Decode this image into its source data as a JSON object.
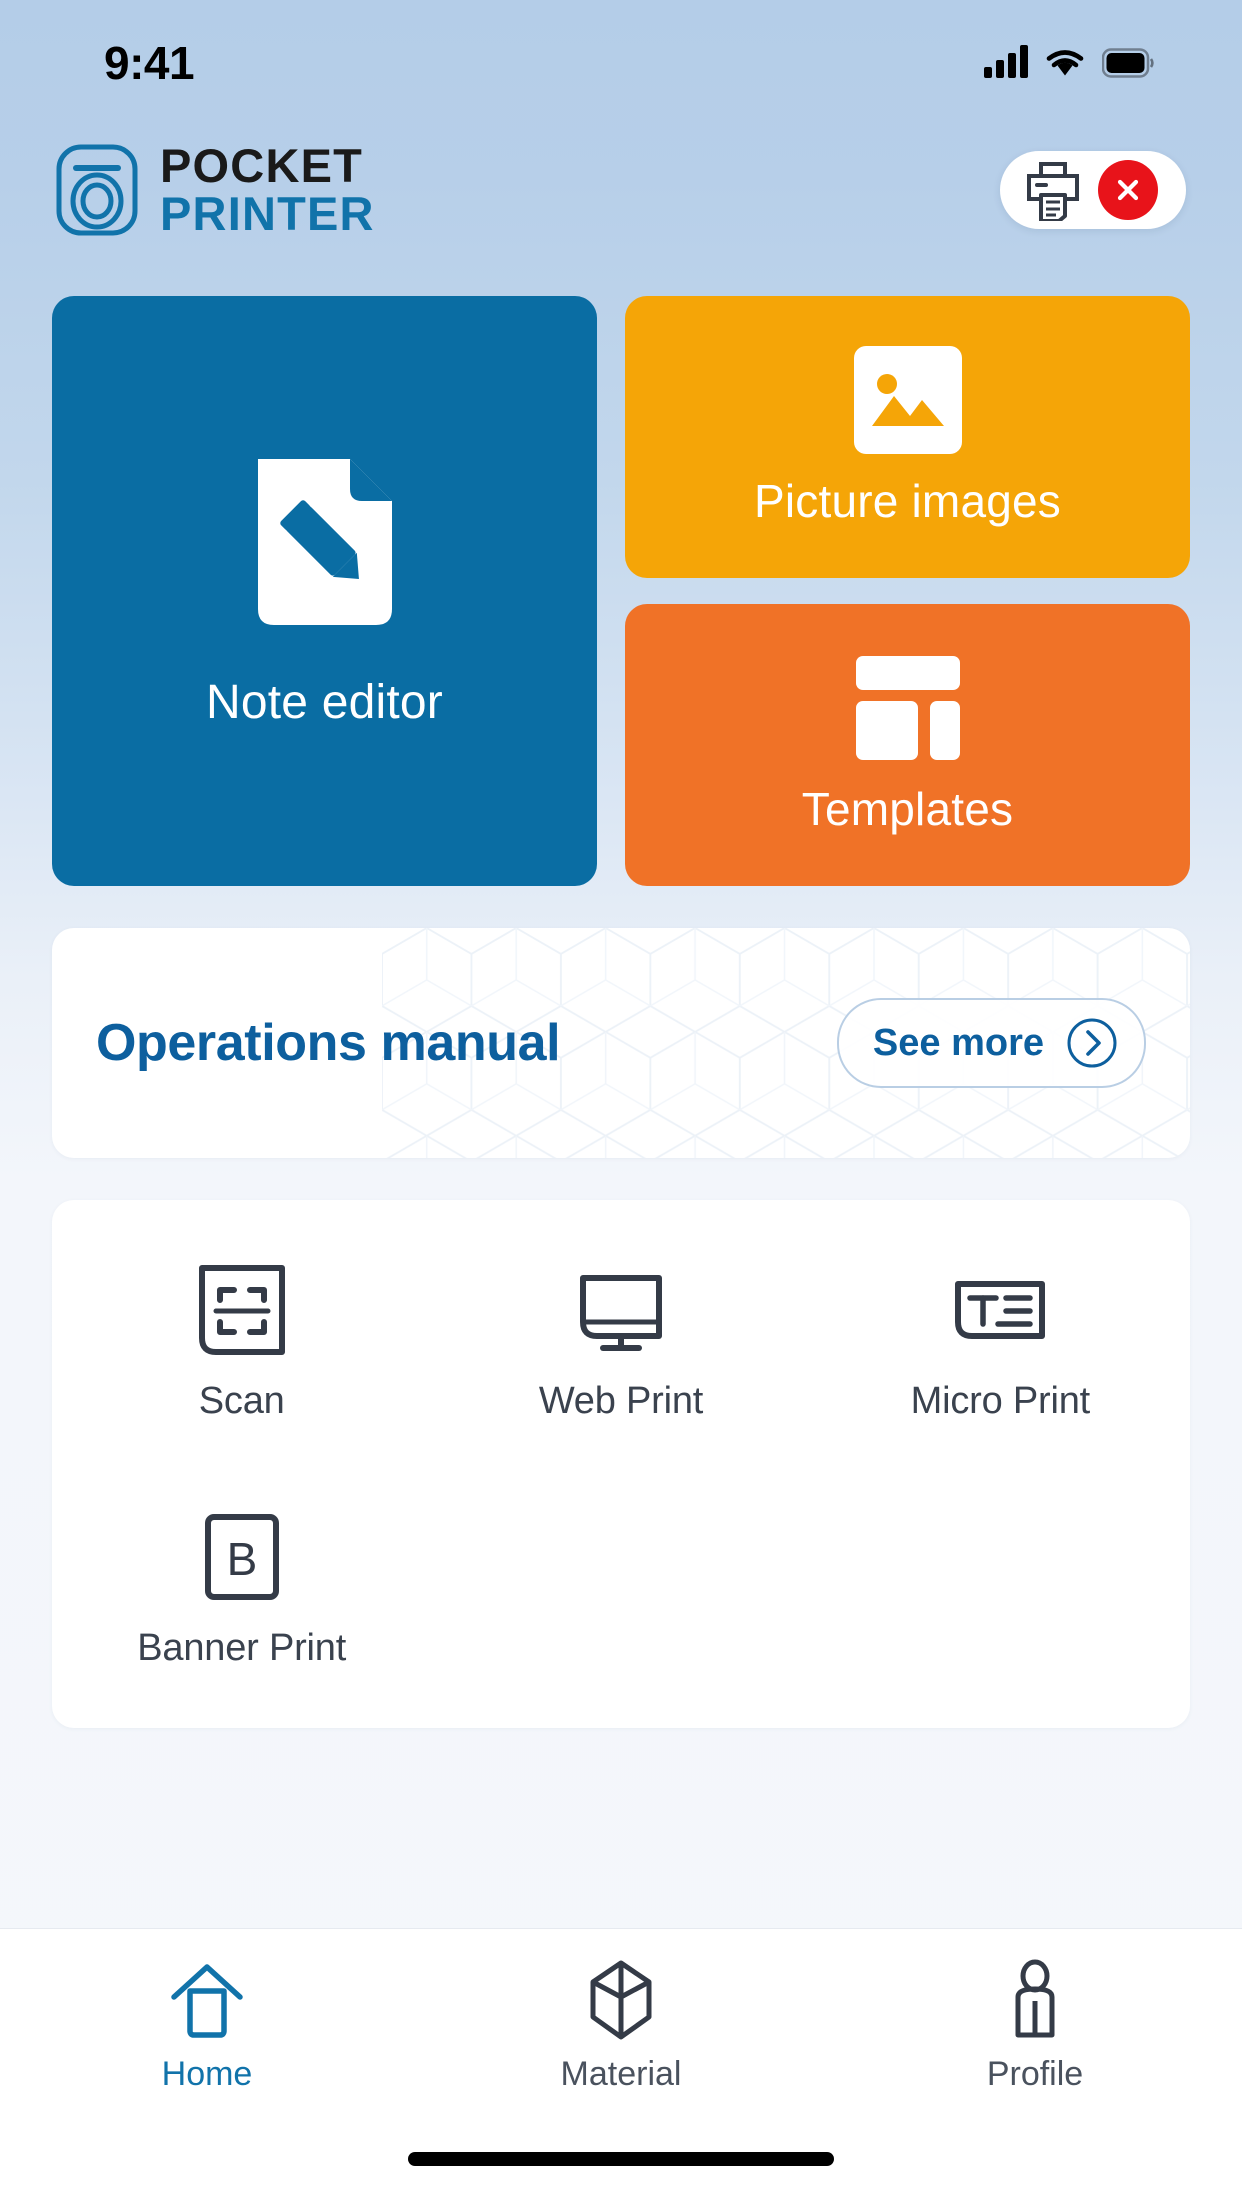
{
  "status_bar": {
    "time": "9:41",
    "signal_icon": "cellular-signal-icon",
    "wifi_icon": "wifi-icon",
    "battery_icon": "battery-full-icon"
  },
  "header": {
    "logo_icon": "pocket-printer-logo-icon",
    "brand_line1": "POCKET",
    "brand_line2": "PRINTER",
    "brand_line2_color": "#1173aa",
    "printer_status": {
      "printer_icon": "printer-icon",
      "badge_icon": "close-x-icon",
      "badge_color": "#e8131a",
      "state": "disconnected"
    }
  },
  "tiles": [
    {
      "id": "note-editor",
      "label": "Note editor",
      "icon": "document-pencil-icon",
      "color": "#0a6da3"
    },
    {
      "id": "picture-images",
      "label": "Picture images",
      "icon": "image-photo-icon",
      "color": "#f5a507"
    },
    {
      "id": "templates",
      "label": "Templates",
      "icon": "layout-grid-icon",
      "color": "#f07227"
    }
  ],
  "manual": {
    "title": "Operations manual",
    "see_more_label": "See more",
    "chevron_icon": "chevron-right-circle-icon",
    "accent_color": "#0d5f9e"
  },
  "features": [
    {
      "id": "scan",
      "label": "Scan",
      "icon": "scan-frame-icon"
    },
    {
      "id": "web-print",
      "label": "Web Print",
      "icon": "monitor-icon"
    },
    {
      "id": "micro-print",
      "label": "Micro Print",
      "icon": "text-lines-icon"
    },
    {
      "id": "banner-print",
      "label": "Banner Print",
      "icon": "letter-b-box-icon"
    }
  ],
  "tabbar": [
    {
      "id": "home",
      "label": "Home",
      "icon": "house-icon",
      "active": true
    },
    {
      "id": "material",
      "label": "Material",
      "icon": "cube-box-icon",
      "active": false
    },
    {
      "id": "profile",
      "label": "Profile",
      "icon": "person-icon",
      "active": false
    }
  ]
}
